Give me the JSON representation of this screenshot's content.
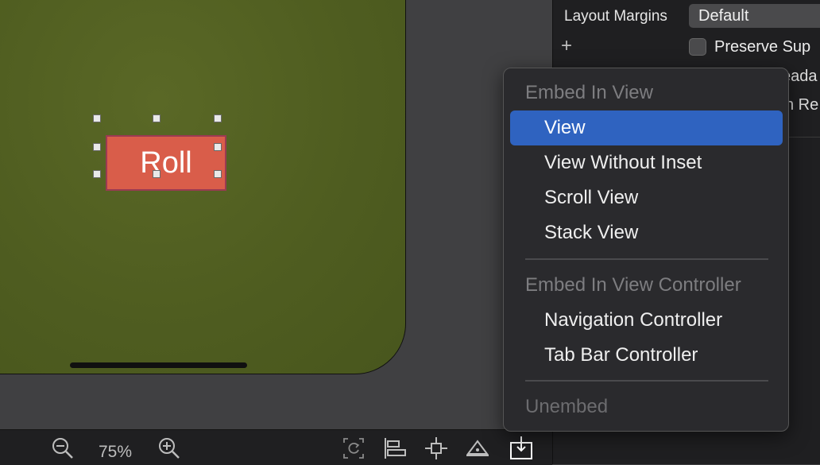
{
  "canvas": {
    "button_label": "Roll",
    "colors": {
      "background": "#4f5d20",
      "button": "#d95d4a",
      "button_border": "#9a3a52"
    }
  },
  "inspector": {
    "layout_margins_label": "Layout Margins",
    "layout_margins_value": "Default",
    "preserve_label": "Preserve Sup",
    "partial_text_1": "eada",
    "partial_text_2": "n Re"
  },
  "bottombar": {
    "zoom_level": "75%"
  },
  "menu": {
    "sections": [
      {
        "header": "Embed In View",
        "items": [
          "View",
          "View Without Inset",
          "Scroll View",
          "Stack View"
        ]
      },
      {
        "header": "Embed In View Controller",
        "items": [
          "Navigation Controller",
          "Tab Bar Controller"
        ]
      }
    ],
    "unembed_label": "Unembed",
    "selected_item": "View",
    "colors": {
      "highlight": "#2f63c0"
    }
  }
}
